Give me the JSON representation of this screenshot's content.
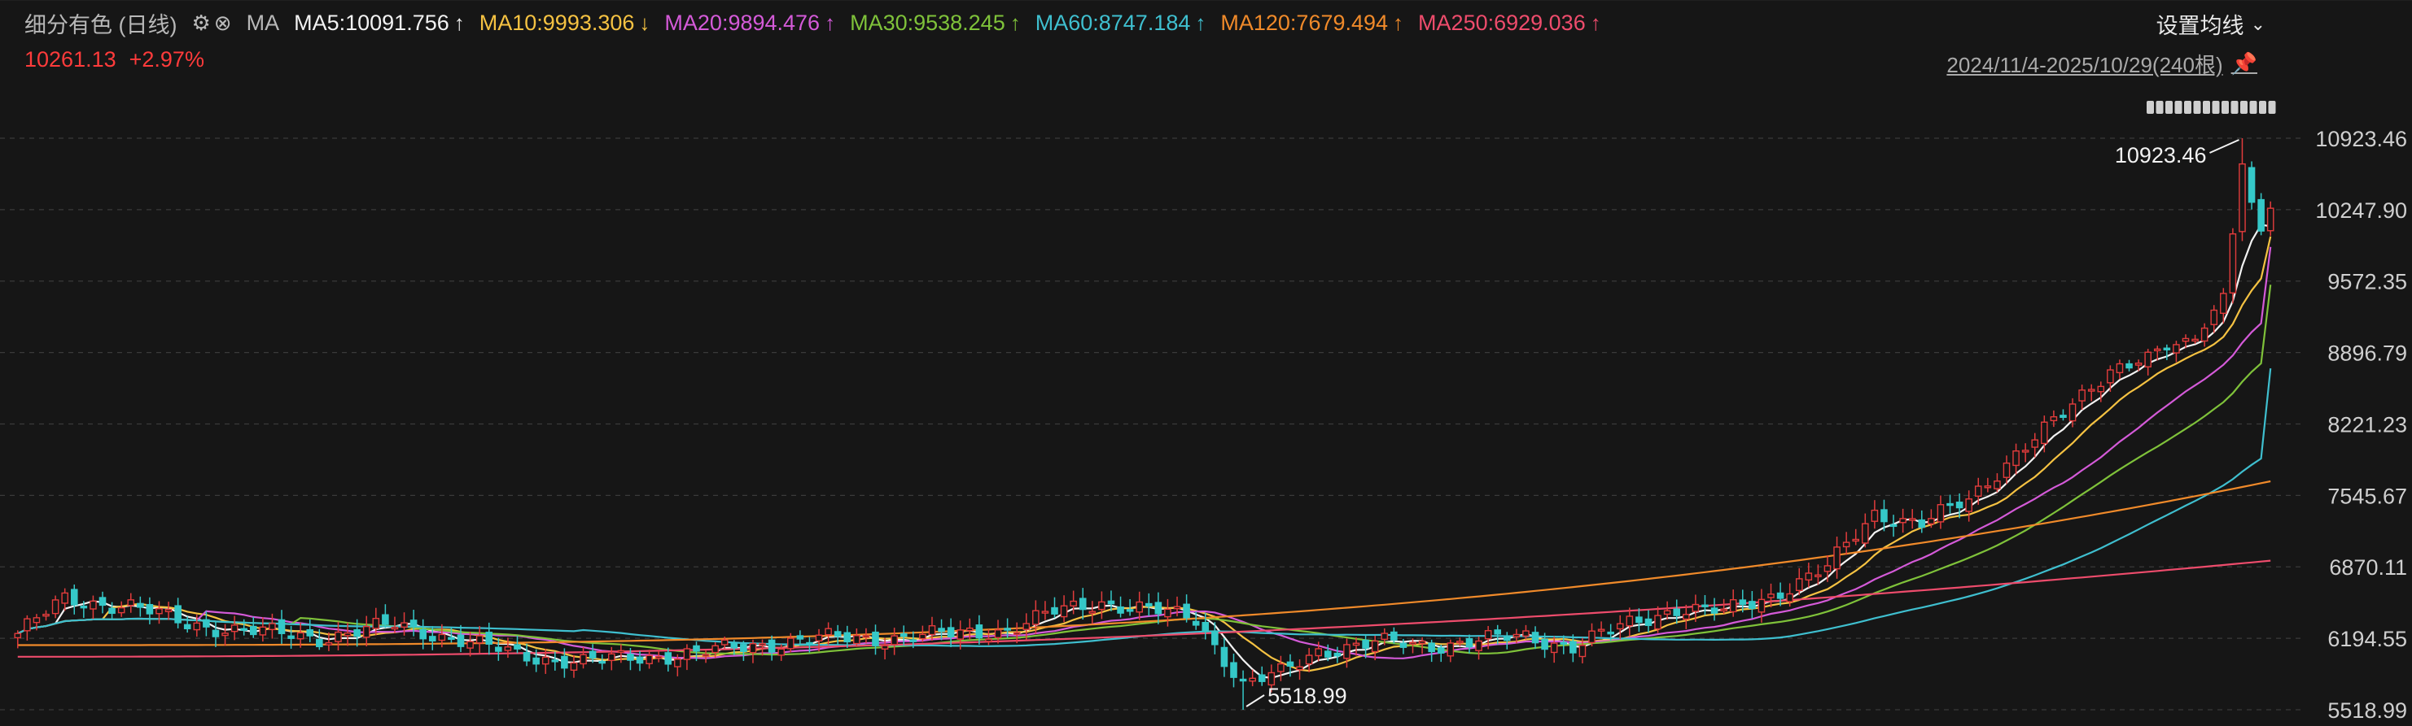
{
  "header": {
    "title": "细分有色 (日线)",
    "ma_label": "MA",
    "ma_items": [
      {
        "label": "MA5:10091.756",
        "arrow": "↑",
        "color": "#f2f2f2"
      },
      {
        "label": "MA10:9993.306",
        "arrow": "↓",
        "color": "#f5c242"
      },
      {
        "label": "MA20:9894.476",
        "arrow": "↑",
        "color": "#d45ad8"
      },
      {
        "label": "MA30:9538.245",
        "arrow": "↑",
        "color": "#7fc23a"
      },
      {
        "label": "MA60:8747.184",
        "arrow": "↑",
        "color": "#3fbfcf"
      },
      {
        "label": "MA120:7679.494",
        "arrow": "↑",
        "color": "#f08a2a"
      },
      {
        "label": "MA250:6929.036",
        "arrow": "↑",
        "color": "#ee4c6c"
      }
    ],
    "price": "10261.13",
    "change": "+2.97%",
    "settings_label": "设置均线",
    "range_label": "2024/11/4-2025/10/29(240根)"
  },
  "colors": {
    "up": "#e23c3c",
    "down": "#35c8c8",
    "grid": "#3a3a3a"
  },
  "chart_data": {
    "type": "candlestick",
    "x_range": [
      "2024/11/4",
      "2025/10/29"
    ],
    "bar_count": 240,
    "y_ticks": [
      "10923.46",
      "10247.90",
      "9572.35",
      "8896.79",
      "8221.23",
      "7545.67",
      "6870.11",
      "6194.55",
      "5518.99"
    ],
    "ylim": [
      5518.99,
      10923.46
    ],
    "high_label": "10923.46",
    "low_label": "5518.99",
    "series": [
      {
        "name": "MA5",
        "color": "#f2f2f2",
        "last": 10091.756
      },
      {
        "name": "MA10",
        "color": "#f5c242",
        "last": 9993.306
      },
      {
        "name": "MA20",
        "color": "#d45ad8",
        "last": 9894.476
      },
      {
        "name": "MA30",
        "color": "#7fc23a",
        "last": 9538.245
      },
      {
        "name": "MA60",
        "color": "#3fbfcf",
        "last": 8747.184
      },
      {
        "name": "MA120",
        "color": "#f08a2a",
        "last": 7679.494
      },
      {
        "name": "MA250",
        "color": "#ee4c6c",
        "last": 6929.036
      }
    ],
    "close_path": [
      [
        0,
        6240
      ],
      [
        5,
        6560
      ],
      [
        12,
        6500
      ],
      [
        18,
        6330
      ],
      [
        25,
        6260
      ],
      [
        32,
        6200
      ],
      [
        40,
        6320
      ],
      [
        47,
        6180
      ],
      [
        53,
        6040
      ],
      [
        60,
        5970
      ],
      [
        66,
        6020
      ],
      [
        72,
        6050
      ],
      [
        78,
        6130
      ],
      [
        85,
        6190
      ],
      [
        92,
        6200
      ],
      [
        99,
        6230
      ],
      [
        105,
        6280
      ],
      [
        110,
        6440
      ],
      [
        115,
        6540
      ],
      [
        120,
        6460
      ],
      [
        125,
        6380
      ],
      [
        130,
        5760
      ],
      [
        134,
        5860
      ],
      [
        138,
        6080
      ],
      [
        144,
        6150
      ],
      [
        150,
        6130
      ],
      [
        156,
        6180
      ],
      [
        160,
        6210
      ],
      [
        165,
        6120
      ],
      [
        170,
        6300
      ],
      [
        176,
        6480
      ],
      [
        181,
        6440
      ],
      [
        186,
        6600
      ],
      [
        192,
        6860
      ],
      [
        197,
        7380
      ],
      [
        202,
        7280
      ],
      [
        207,
        7500
      ],
      [
        212,
        7950
      ],
      [
        217,
        8300
      ],
      [
        222,
        8750
      ],
      [
        227,
        8900
      ],
      [
        231,
        9020
      ],
      [
        234,
        9450
      ],
      [
        235,
        10050
      ],
      [
        236,
        10923
      ],
      [
        237,
        10300
      ],
      [
        238,
        10020
      ],
      [
        239,
        10261
      ]
    ]
  }
}
